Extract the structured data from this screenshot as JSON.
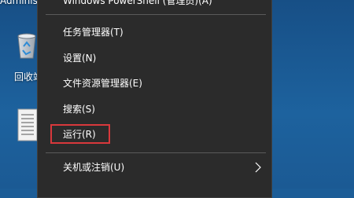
{
  "desktop": {
    "top_text": "Administr",
    "recycle_bin_label": "回收站"
  },
  "menu": {
    "top_partial": "Windows PowerShell (管理员)(A)",
    "items": [
      {
        "label": "任务管理器(T)"
      },
      {
        "label": "设置(N)"
      },
      {
        "label": "文件资源管理器(E)"
      },
      {
        "label": "搜索(S)"
      },
      {
        "label": "运行(R)"
      },
      {
        "label": "关机或注销(U)"
      }
    ],
    "highlight_color": "#d9383c"
  },
  "icons": {
    "recycle": "recycle-bin-icon",
    "document": "document-icon",
    "submenu": "chevron-right-icon"
  }
}
